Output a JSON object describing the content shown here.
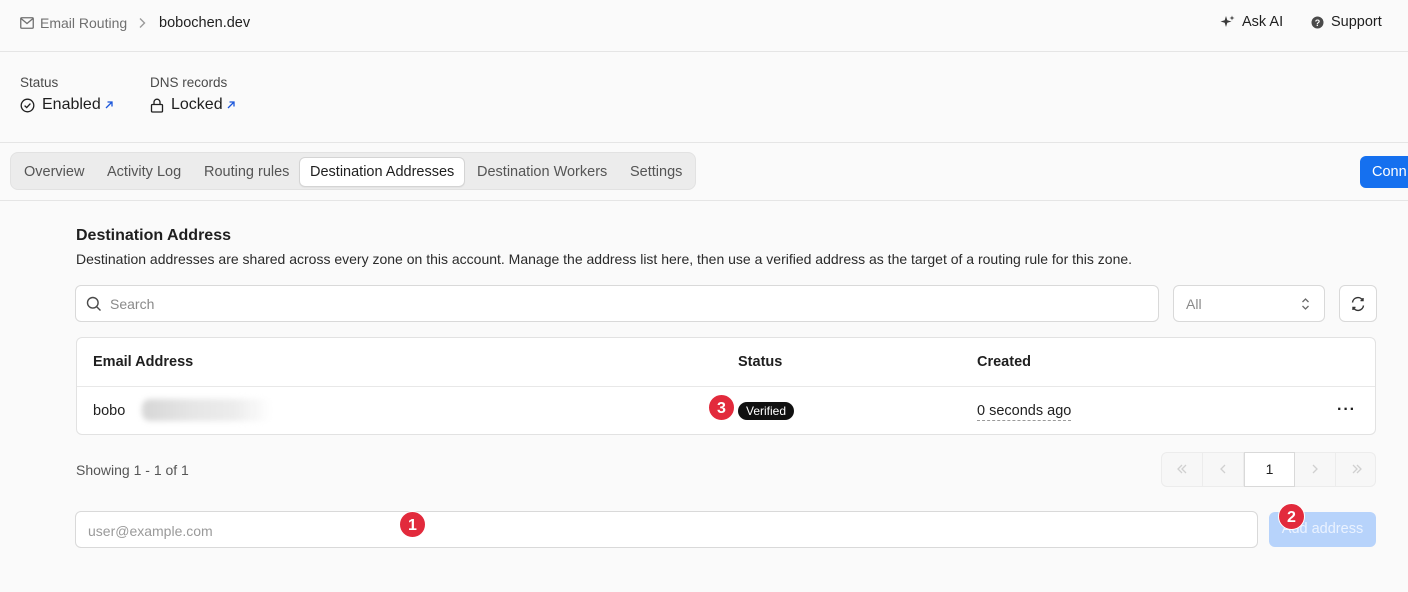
{
  "header": {
    "breadcrumb": [
      "Email Routing",
      "bobochen.dev"
    ],
    "ask_ai": "Ask AI",
    "support": "Support"
  },
  "status": {
    "status_label": "Status",
    "status_value": "Enabled",
    "dns_label": "DNS records",
    "dns_value": "Locked"
  },
  "tabs": [
    "Overview",
    "Activity Log",
    "Routing rules",
    "Destination Addresses",
    "Destination Workers",
    "Settings"
  ],
  "active_tab": "Destination Addresses",
  "connect_button": "Conn",
  "section": {
    "title": "Destination Address",
    "description": "Destination addresses are shared across every zone on this account. Manage the address list here, then use a verified address as the target of a routing rule for this zone."
  },
  "search": {
    "placeholder": "Search"
  },
  "filter": {
    "value": "All"
  },
  "table": {
    "columns": [
      "Email Address",
      "Status",
      "Created"
    ],
    "rows": [
      {
        "email": "bobo",
        "status": "Verified",
        "created": "0 seconds ago"
      }
    ]
  },
  "pagination": {
    "showing": "Showing 1 - 1 of 1",
    "current_page": "1"
  },
  "add_form": {
    "placeholder": "user@example.com",
    "button": "Add address"
  },
  "markers": [
    "1",
    "2",
    "3"
  ],
  "colors": {
    "accent": "#1570ef",
    "marker": "#e22a3c",
    "badge": "#111111"
  }
}
